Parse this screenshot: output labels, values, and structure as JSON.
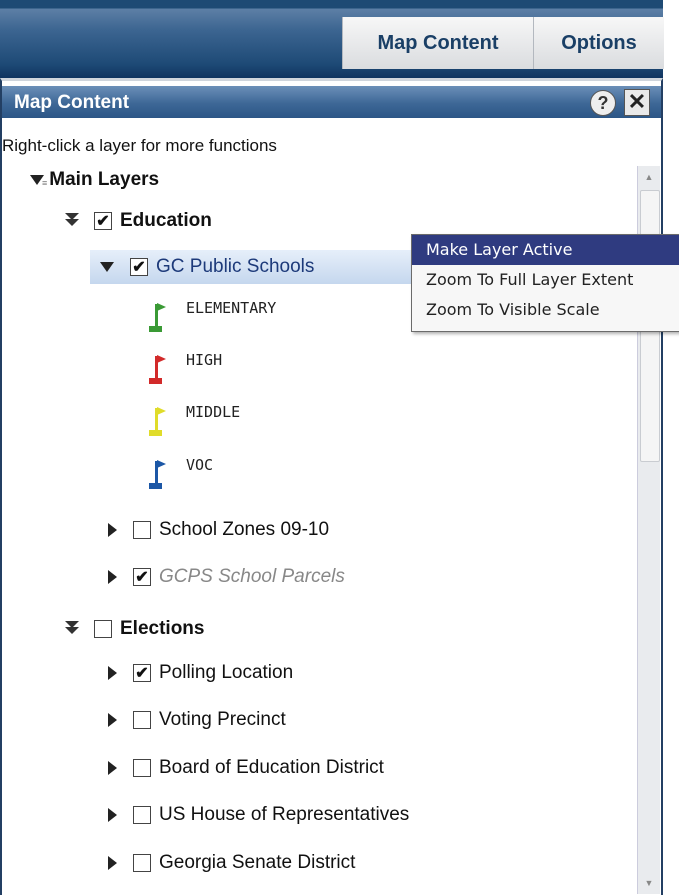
{
  "header": {
    "tabs": [
      {
        "label": "Map Content"
      },
      {
        "label": "Options"
      }
    ]
  },
  "panel": {
    "title": "Map Content",
    "help_glyph": "?",
    "close_glyph": "✕",
    "hint": "Right-click a layer for more functions"
  },
  "tree": {
    "main_layers": "Main Layers",
    "education": {
      "label": "Education",
      "checked": "✔",
      "gc_public_schools": {
        "label": "GC Public Schools",
        "checked": "✔"
      },
      "legend": [
        {
          "label": "ELEMENTARY",
          "color": "#3a9a35"
        },
        {
          "label": "HIGH",
          "color": "#d22a2a"
        },
        {
          "label": "MIDDLE",
          "color": "#e0dc2a"
        },
        {
          "label": "VOC",
          "color": "#1c57a6"
        }
      ],
      "school_zones": {
        "label": "School Zones 09-10",
        "checked": ""
      },
      "gcps_parcels": {
        "label": "GCPS School Parcels",
        "checked": "✔"
      }
    },
    "elections": {
      "label": "Elections",
      "checked": "",
      "children": [
        {
          "label": "Polling Location",
          "checked": "✔"
        },
        {
          "label": "Voting Precinct",
          "checked": ""
        },
        {
          "label": "Board of Education District",
          "checked": ""
        },
        {
          "label": "US House of Representatives",
          "checked": ""
        },
        {
          "label": "Georgia Senate District",
          "checked": ""
        }
      ]
    }
  },
  "context_menu": {
    "items": [
      {
        "label": "Make Layer Active"
      },
      {
        "label": "Zoom To Full Layer Extent"
      },
      {
        "label": "Zoom To Visible Scale"
      }
    ]
  },
  "icons": {
    "scroll_up": "▲",
    "scroll_down": "▼"
  }
}
